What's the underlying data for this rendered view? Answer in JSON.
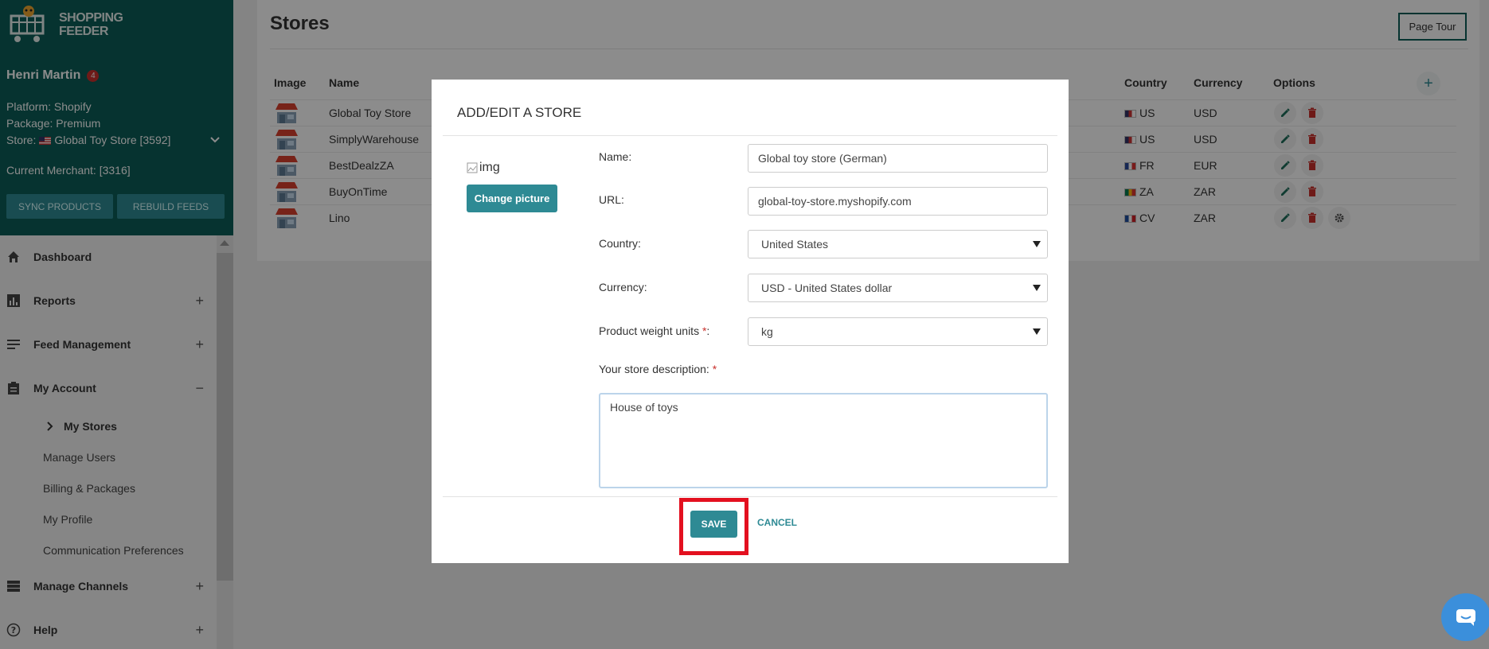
{
  "app": {
    "logo_text_1": "SHOPPING",
    "logo_text_2": "FEEDER",
    "user_name": "Henri Martin",
    "notification_count": "4",
    "platform": "Platform: Shopify",
    "package": "Package: Premium",
    "store_prefix": "Store:",
    "store_value": "Global Toy Store [3592]",
    "merchant": "Current Merchant: [3316]",
    "sync_label": "SYNC PRODUCTS",
    "rebuild_label": "REBUILD FEEDS"
  },
  "nav": {
    "dashboard": "Dashboard",
    "reports": "Reports",
    "feed_management": "Feed Management",
    "my_account": "My Account",
    "my_stores": "My Stores",
    "manage_users": "Manage Users",
    "billing": "Billing & Packages",
    "my_profile": "My Profile",
    "communication": "Communication Preferences",
    "manage_channels": "Manage Channels",
    "help": "Help",
    "plus": "+",
    "minus": "−"
  },
  "page": {
    "title": "Stores",
    "page_tour": "Page Tour",
    "columns": {
      "image": "Image",
      "name": "Name",
      "country": "Country",
      "currency": "Currency",
      "options": "Options"
    },
    "rows": [
      {
        "name": "Global Toy Store",
        "country": "US",
        "currency": "USD"
      },
      {
        "name": "SimplyWarehouse",
        "country": "US",
        "currency": "USD"
      },
      {
        "name": "BestDealzZA",
        "country": "FR",
        "currency": "EUR"
      },
      {
        "name": "BuyOnTime",
        "country": "ZA",
        "currency": "ZAR"
      },
      {
        "name": "Lino",
        "country": "CV",
        "currency": "ZAR"
      }
    ]
  },
  "modal": {
    "title": "ADD/EDIT A STORE",
    "img_alt": "img",
    "change_picture": "Change picture",
    "name_label": "Name:",
    "name_value": "Global toy store (German)",
    "url_label": "URL:",
    "url_value": "global-toy-store.myshopify.com",
    "country_label": "Country:",
    "country_value": "United States",
    "currency_label": "Currency:",
    "currency_value": "USD - United States dollar",
    "weight_label": "Product weight units",
    "weight_value": "kg",
    "req_mark": "*",
    "colon": ":",
    "description_label": "Your store description:",
    "description_value": "House of toys",
    "save": "SAVE",
    "cancel": "CANCEL"
  },
  "colors": {
    "brand": "#0b5e58",
    "accent": "#2e8a94",
    "danger": "#c9302c",
    "highlight": "#e3101f"
  }
}
